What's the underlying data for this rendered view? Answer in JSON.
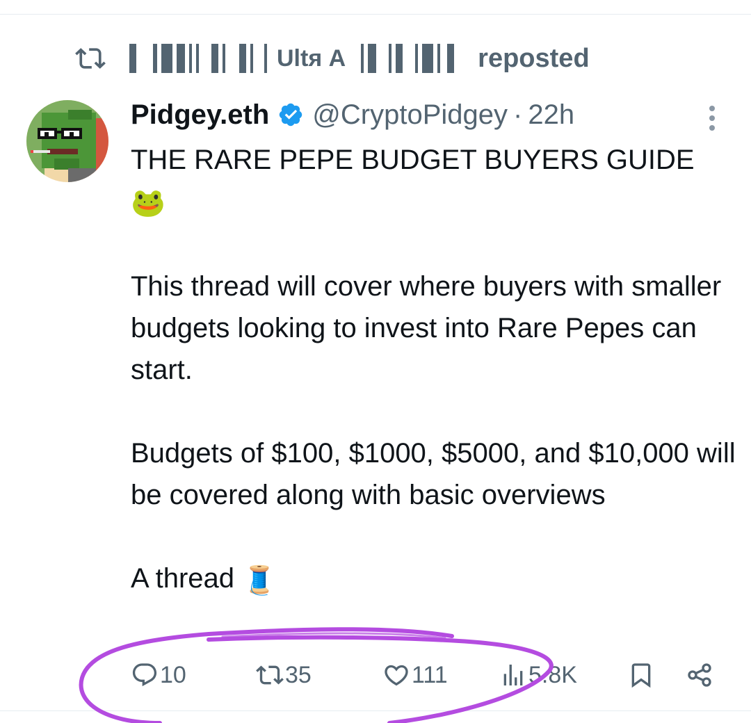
{
  "repost_banner": {
    "label_mid": "Ultя A",
    "label_end": "reposted"
  },
  "tweet": {
    "author_name": "Pidgey.eth",
    "handle": "@CryptoPidgey",
    "separator": "·",
    "time": "22h",
    "title_line": "THE RARE PEPE BUDGET BUYERS GUIDE",
    "title_emoji": "🐸",
    "paragraph_1": "This thread will cover where buyers with smaller budgets looking to invest into Rare Pepes can start.",
    "paragraph_2": "Budgets of $100, $1000, $5000, and $10,000 will be covered along with  basic overviews",
    "paragraph_3": "A thread",
    "thread_emoji": "🧵"
  },
  "actions": {
    "replies": "10",
    "reposts": "35",
    "likes": "111",
    "views": "5.8K"
  },
  "colors": {
    "text": "#0f1419",
    "muted": "#536471",
    "verified": "#1d9bf0",
    "annotation": "#b44ce0"
  },
  "icons": [
    "repost-icon",
    "verified-badge-icon",
    "more-icon",
    "reply-icon",
    "views-icon",
    "like-icon",
    "bookmark-icon",
    "share-icon"
  ]
}
